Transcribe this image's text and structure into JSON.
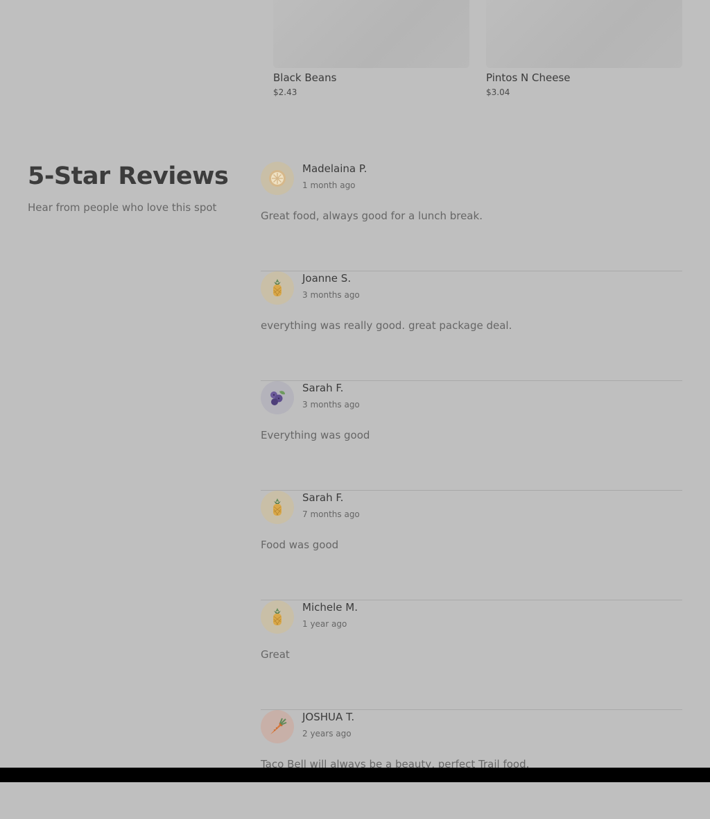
{
  "products": [
    {
      "name": "Black Beans",
      "price": "$2.43"
    },
    {
      "name": "Pintos N Cheese",
      "price": "$3.04"
    }
  ],
  "reviews_section": {
    "title": "5-Star Reviews",
    "subtitle": "Hear from people who love this spot"
  },
  "reviews": [
    {
      "name": "Madelaina P.",
      "time": "1 month ago",
      "text": "Great food, always good for a lunch break.",
      "avatar_icon": "lemon-icon",
      "avatar_bg": "#c9bfa7"
    },
    {
      "name": "Joanne S.",
      "time": "3 months ago",
      "text": "everything was really good. great package deal.",
      "avatar_icon": "pineapple-icon",
      "avatar_bg": "#c9bfa7"
    },
    {
      "name": "Sarah F.",
      "time": "3 months ago",
      "text": "Everything was good",
      "avatar_icon": "blueberry-icon",
      "avatar_bg": "#b4b3bb"
    },
    {
      "name": "Sarah F.",
      "time": "7 months ago",
      "text": "Food was good",
      "avatar_icon": "pineapple-icon",
      "avatar_bg": "#c9bfa7"
    },
    {
      "name": "Michele M.",
      "time": "1 year ago",
      "text": "Great",
      "avatar_icon": "pineapple-icon",
      "avatar_bg": "#c9bfa7"
    },
    {
      "name": "JOSHUA T.",
      "time": "2 years ago",
      "text": "Taco Bell will always be a beauty, perfect Trail food.",
      "avatar_icon": "carrot-icon",
      "avatar_bg": "#c8b0a8"
    }
  ]
}
